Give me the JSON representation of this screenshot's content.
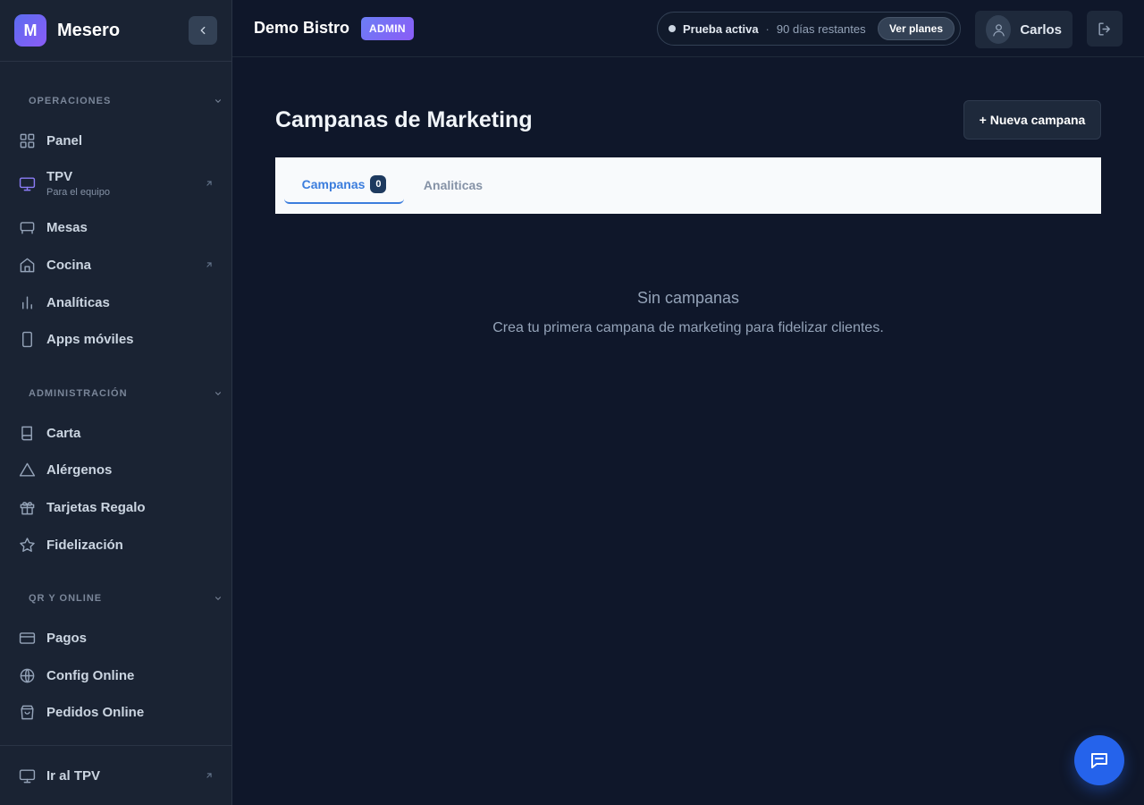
{
  "app": {
    "logo_letter": "M",
    "name": "Mesero"
  },
  "sidebar": {
    "sections": [
      {
        "title": "OPERACIONES"
      },
      {
        "title": "ADMINISTRACIÓN"
      },
      {
        "title": "QR Y ONLINE"
      }
    ],
    "items": [
      {
        "label": "Panel",
        "icon": "grid-icon"
      },
      {
        "label": "TPV",
        "sublabel": "Para el equipo",
        "icon": "monitor-icon",
        "external": true
      },
      {
        "label": "Mesas",
        "icon": "table-icon"
      },
      {
        "label": "Cocina",
        "icon": "home-icon",
        "external": true
      },
      {
        "label": "Analíticas",
        "icon": "bar-chart-icon"
      },
      {
        "label": "Apps móviles",
        "icon": "phone-icon"
      },
      {
        "label": "Carta",
        "icon": "book-icon"
      },
      {
        "label": "Alérgenos",
        "icon": "warning-icon"
      },
      {
        "label": "Tarjetas Regalo",
        "icon": "gift-icon"
      },
      {
        "label": "Fidelización",
        "icon": "star-icon"
      },
      {
        "label": "Pagos",
        "icon": "credit-card-icon"
      },
      {
        "label": "Config Online",
        "icon": "globe-icon"
      },
      {
        "label": "Pedidos Online",
        "icon": "shopping-bag-icon"
      }
    ],
    "footer": {
      "label": "Ir al TPV",
      "icon": "monitor-icon",
      "external": true
    }
  },
  "header": {
    "restaurant": "Demo Bistro",
    "role": "ADMIN",
    "trial": {
      "status": "Prueba activa",
      "separator": "·",
      "remaining": "90 días restantes",
      "button": "Ver planes"
    },
    "user": {
      "name": "Carlos"
    }
  },
  "main": {
    "title": "Campanas de Marketing",
    "new_button": "+ Nueva campana",
    "tabs": [
      {
        "label": "Campanas",
        "count": "0",
        "active": true
      },
      {
        "label": "Analiticas",
        "active": false
      }
    ],
    "empty": {
      "title": "Sin campanas",
      "description": "Crea tu primera campana de marketing para fidelizar clientes."
    }
  },
  "colors": {
    "accent": "#3b7ddd",
    "brand": "#6b6ef2",
    "chat_button": "#2563eb"
  }
}
